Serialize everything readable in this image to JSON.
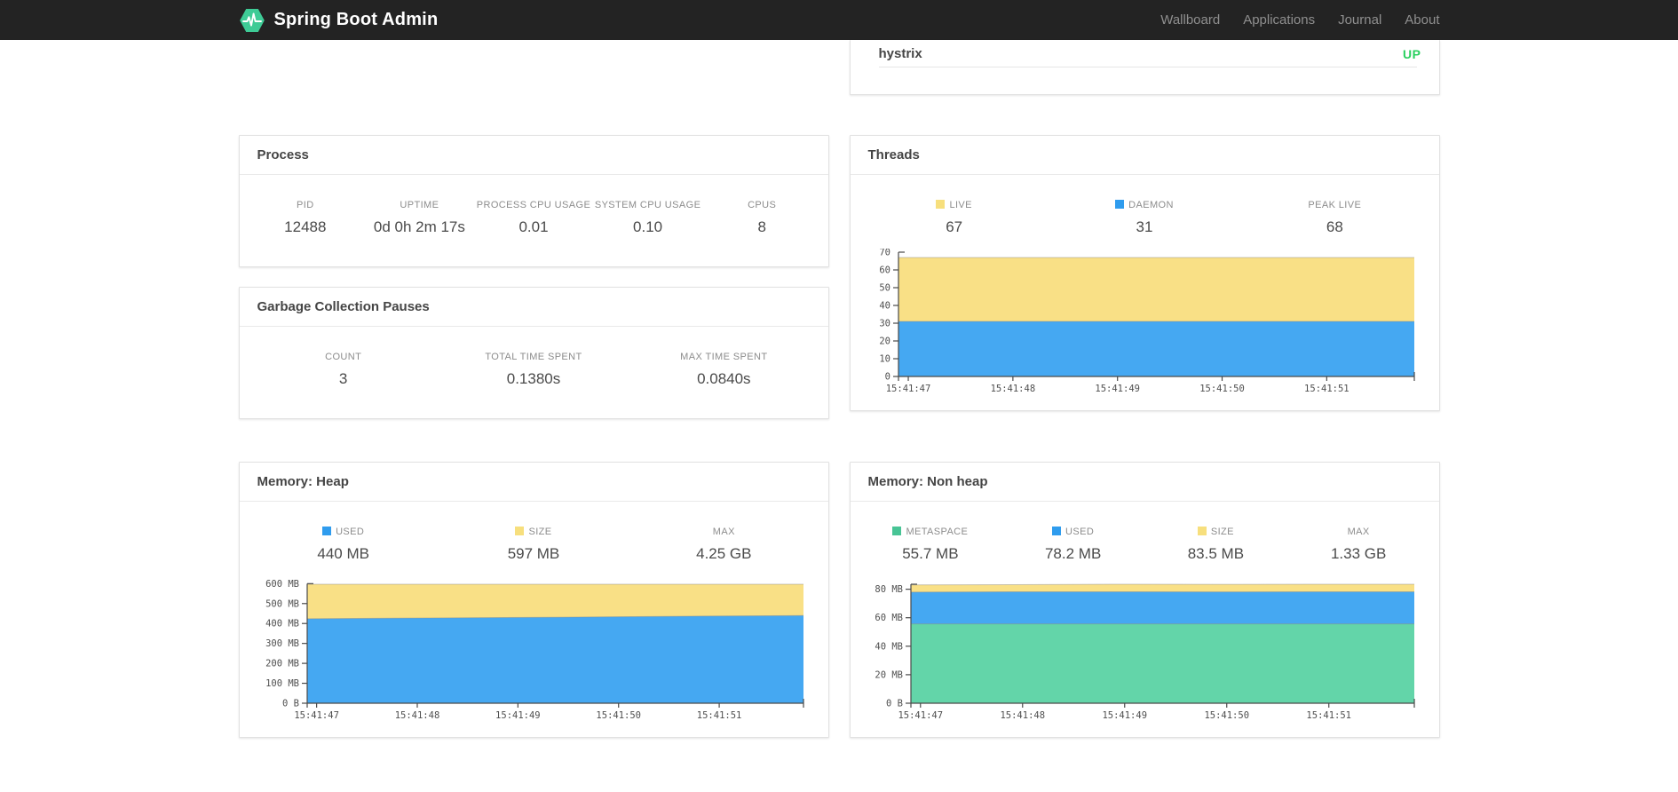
{
  "navbar": {
    "brand": "Spring Boot Admin",
    "items": [
      {
        "label": "Wallboard"
      },
      {
        "label": "Applications"
      },
      {
        "label": "Journal"
      },
      {
        "label": "About"
      }
    ]
  },
  "application": {
    "name": "hystrix",
    "status": "UP",
    "status_color": "#2ad05f"
  },
  "process": {
    "title": "Process",
    "stats": [
      {
        "label": "PID",
        "value": "12488"
      },
      {
        "label": "UPTIME",
        "value": "0d 0h 2m 17s"
      },
      {
        "label": "PROCESS CPU USAGE",
        "value": "0.01"
      },
      {
        "label": "SYSTEM CPU USAGE",
        "value": "0.10"
      },
      {
        "label": "CPUS",
        "value": "8"
      }
    ]
  },
  "gc": {
    "title": "Garbage Collection Pauses",
    "stats": [
      {
        "label": "COUNT",
        "value": "3"
      },
      {
        "label": "TOTAL TIME SPENT",
        "value": "0.1380s"
      },
      {
        "label": "MAX TIME SPENT",
        "value": "0.0840s"
      }
    ]
  },
  "threads": {
    "title": "Threads",
    "stats": [
      {
        "label": "LIVE",
        "value": "67",
        "color": "#f7df7d"
      },
      {
        "label": "DAEMON",
        "value": "31",
        "color": "#2f9cee"
      },
      {
        "label": "PEAK LIVE",
        "value": "68"
      }
    ]
  },
  "heap": {
    "title": "Memory: Heap",
    "stats": [
      {
        "label": "USED",
        "value": "440 MB",
        "color": "#2f9cee"
      },
      {
        "label": "SIZE",
        "value": "597 MB",
        "color": "#f7df7d"
      },
      {
        "label": "MAX",
        "value": "4.25 GB"
      }
    ]
  },
  "nonheap": {
    "title": "Memory: Non heap",
    "stats": [
      {
        "label": "METASPACE",
        "value": "55.7 MB",
        "color": "#48c495"
      },
      {
        "label": "USED",
        "value": "78.2 MB",
        "color": "#2f9cee"
      },
      {
        "label": "SIZE",
        "value": "83.5 MB",
        "color": "#f7df7d"
      },
      {
        "label": "MAX",
        "value": "1.33 GB"
      }
    ]
  },
  "chart_data": [
    {
      "id": "threads",
      "type": "area",
      "title": "Threads",
      "x_tick_labels": [
        "15:41:47",
        "15:41:48",
        "15:41:49",
        "15:41:50",
        "15:41:51"
      ],
      "ylim": [
        0,
        70
      ],
      "plot_top": 67,
      "grid": false,
      "y_ticks": [
        {
          "v": 0,
          "label": "0"
        },
        {
          "v": 10,
          "label": "10"
        },
        {
          "v": 20,
          "label": "20"
        },
        {
          "v": 30,
          "label": "30"
        },
        {
          "v": 40,
          "label": "40"
        },
        {
          "v": 50,
          "label": "50"
        },
        {
          "v": 60,
          "label": "60"
        },
        {
          "v": 70,
          "label": "70"
        }
      ],
      "layers": [
        {
          "name": "live",
          "color": "#f9e086",
          "values": [
            67,
            67,
            67,
            67,
            67,
            67
          ]
        },
        {
          "name": "daemon",
          "color": "#45a8f2",
          "values": [
            31,
            31,
            31,
            31,
            31,
            31
          ]
        }
      ]
    },
    {
      "id": "heap",
      "type": "area",
      "title": "Memory: Heap",
      "x_tick_labels": [
        "15:41:47",
        "15:41:48",
        "15:41:49",
        "15:41:50",
        "15:41:51"
      ],
      "ylim": [
        0,
        600
      ],
      "plot_top": 597,
      "grid": false,
      "y_ticks": [
        {
          "v": 0,
          "label": "0 B"
        },
        {
          "v": 100,
          "label": "100 MB"
        },
        {
          "v": 200,
          "label": "200 MB"
        },
        {
          "v": 300,
          "label": "300 MB"
        },
        {
          "v": 400,
          "label": "400 MB"
        },
        {
          "v": 500,
          "label": "500 MB"
        },
        {
          "v": 600,
          "label": "600 MB"
        }
      ],
      "layers": [
        {
          "name": "size",
          "color": "#f9e086",
          "values": [
            597,
            597,
            597,
            597,
            597,
            597
          ]
        },
        {
          "name": "used",
          "color": "#45a8f2",
          "values": [
            424,
            427,
            430,
            433,
            437,
            440
          ]
        }
      ]
    },
    {
      "id": "nonheap",
      "type": "area",
      "title": "Memory: Non heap",
      "x_tick_labels": [
        "15:41:47",
        "15:41:48",
        "15:41:49",
        "15:41:50",
        "15:41:51"
      ],
      "ylim": [
        0,
        80
      ],
      "plot_top": 83.5,
      "grid": false,
      "y_ticks": [
        {
          "v": 0,
          "label": "0 B"
        },
        {
          "v": 20,
          "label": "20 MB"
        },
        {
          "v": 40,
          "label": "40 MB"
        },
        {
          "v": 60,
          "label": "60 MB"
        },
        {
          "v": 80,
          "label": "80 MB"
        }
      ],
      "layers": [
        {
          "name": "size",
          "color": "#f9e086",
          "values": [
            83.0,
            83.2,
            83.5,
            83.4,
            83.5,
            83.5
          ]
        },
        {
          "name": "used",
          "color": "#45a8f2",
          "values": [
            78.0,
            78.2,
            78.2,
            78.1,
            78.2,
            78.2
          ]
        },
        {
          "name": "metaspace",
          "color": "#63d5a9",
          "values": [
            55.7,
            55.7,
            55.7,
            55.7,
            55.7,
            55.7
          ]
        }
      ]
    }
  ]
}
